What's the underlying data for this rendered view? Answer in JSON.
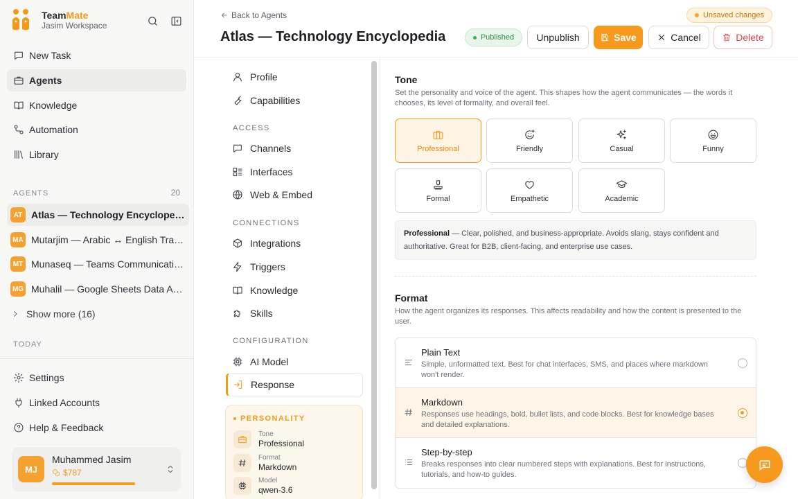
{
  "brand": {
    "name_part1": "Team",
    "name_part2": "Mate",
    "workspace": "Jasim Workspace"
  },
  "nav": [
    {
      "label": "New Task",
      "icon": "chat-bubble-icon"
    },
    {
      "label": "Agents",
      "icon": "briefcase-icon",
      "active": true
    },
    {
      "label": "Knowledge",
      "icon": "book-icon"
    },
    {
      "label": "Automation",
      "icon": "flow-icon"
    },
    {
      "label": "Library",
      "icon": "library-icon"
    }
  ],
  "agents_section": {
    "label": "AGENTS",
    "count": "20"
  },
  "agents": [
    {
      "badge": "AT",
      "name": "Atlas — Technology Encyclopedia",
      "active": true
    },
    {
      "badge": "MA",
      "name": "Mutarjim — Arabic ↔ English Translator"
    },
    {
      "badge": "MT",
      "name": "Munaseq — Teams Communication Assistant"
    },
    {
      "badge": "MG",
      "name": "Muhalil — Google Sheets Data Analyst"
    }
  ],
  "show_more": "Show more (16)",
  "today_label": "TODAY",
  "bottom_nav": [
    {
      "label": "Settings",
      "icon": "gear-icon"
    },
    {
      "label": "Linked Accounts",
      "icon": "plug-icon"
    },
    {
      "label": "Help & Feedback",
      "icon": "help-circle-icon"
    }
  ],
  "user": {
    "initials": "MJ",
    "name": "Muhammed Jasim",
    "credit": "$787"
  },
  "header": {
    "back": "Back to Agents",
    "title": "Atlas — Technology Encyclopedia",
    "unsaved": "Unsaved changes",
    "published": "Published",
    "unpublish": "Unpublish",
    "save": "Save",
    "cancel": "Cancel",
    "delete": "Delete"
  },
  "subnav": {
    "top": [
      {
        "label": "Profile",
        "icon": "user-icon"
      },
      {
        "label": "Capabilities",
        "icon": "wrench-icon"
      }
    ],
    "access_label": "ACCESS",
    "access": [
      {
        "label": "Channels",
        "icon": "chat-bubble-icon"
      },
      {
        "label": "Interfaces",
        "icon": "layout-icon"
      },
      {
        "label": "Web & Embed",
        "icon": "globe-icon"
      }
    ],
    "connections_label": "CONNECTIONS",
    "connections": [
      {
        "label": "Integrations",
        "icon": "cube-icon"
      },
      {
        "label": "Triggers",
        "icon": "bolt-icon"
      },
      {
        "label": "Knowledge",
        "icon": "book-icon"
      },
      {
        "label": "Skills",
        "icon": "puzzle-icon"
      }
    ],
    "configuration_label": "CONFIGURATION",
    "configuration": [
      {
        "label": "AI Model",
        "icon": "chip-icon"
      },
      {
        "label": "Response",
        "icon": "response-icon",
        "active": true
      }
    ]
  },
  "personality": {
    "title": "PERSONALITY",
    "rows": [
      {
        "key": "Tone",
        "value": "Professional",
        "icon": "briefcase-icon"
      },
      {
        "key": "Format",
        "value": "Markdown",
        "icon": "hash-icon"
      },
      {
        "key": "Model",
        "value": "qwen-3.6",
        "icon": "chip-icon"
      }
    ]
  },
  "tone": {
    "title": "Tone",
    "description": "Set the personality and voice of the agent. This shapes how the agent communicates — the words it chooses, its level of formality, and overall feel.",
    "options": [
      {
        "label": "Professional",
        "icon": "briefcase-icon",
        "selected": true
      },
      {
        "label": "Friendly",
        "icon": "smile-plus-icon"
      },
      {
        "label": "Casual",
        "icon": "sparkles-icon"
      },
      {
        "label": "Funny",
        "icon": "laugh-icon"
      },
      {
        "label": "Formal",
        "icon": "stamp-icon"
      },
      {
        "label": "Empathetic",
        "icon": "heart-icon"
      },
      {
        "label": "Academic",
        "icon": "graduation-cap-icon"
      }
    ],
    "selected_name": "Professional",
    "selected_desc": " — Clear, polished, and business-appropriate. Avoids slang, stays confident and authoritative. Great for B2B, client-facing, and enterprise use cases."
  },
  "format": {
    "title": "Format",
    "description": "How the agent organizes its responses. This affects readability and how the content is presented to the user.",
    "options": [
      {
        "name": "Plain Text",
        "desc": "Simple, unformatted text. Best for chat interfaces, SMS, and places where markdown won't render.",
        "icon": "text-lines-icon",
        "selected": false
      },
      {
        "name": "Markdown",
        "desc": "Responses use headings, bold, bullet lists, and code blocks. Best for knowledge bases and detailed explanations.",
        "icon": "hash-icon",
        "selected": true
      },
      {
        "name": "Step-by-step",
        "desc": "Breaks responses into clear numbered steps with explanations. Best for instructions, tutorials, and how-to guides.",
        "icon": "list-icon",
        "selected": false
      }
    ]
  },
  "colors": {
    "accent": "#f39a1c",
    "published": "#3fae4f",
    "danger": "#e0464d"
  }
}
